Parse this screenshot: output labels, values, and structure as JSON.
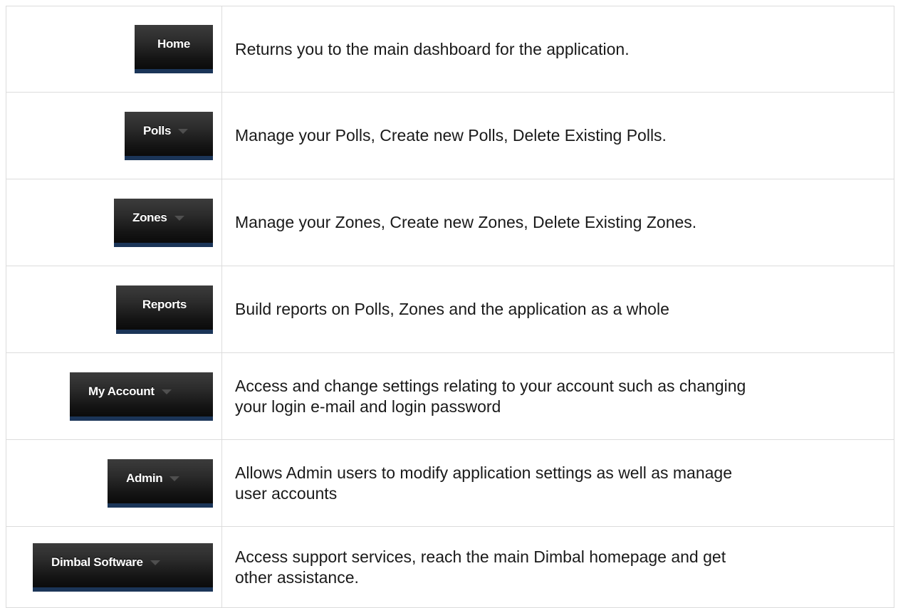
{
  "rows": [
    {
      "button_label": "Home",
      "has_caret": false,
      "description": "Returns you to the main dashboard for the application."
    },
    {
      "button_label": "Polls",
      "has_caret": true,
      "description": "Manage your Polls, Create new Polls, Delete Existing Polls."
    },
    {
      "button_label": "Zones",
      "has_caret": true,
      "description": "Manage your Zones, Create new Zones, Delete Existing Zones."
    },
    {
      "button_label": "Reports",
      "has_caret": false,
      "description": "Build reports on Polls, Zones and the application as a whole"
    },
    {
      "button_label": "My Account",
      "has_caret": true,
      "description_lines": [
        "Access and change settings relating to your account such as changing",
        "your login e-mail and login password"
      ]
    },
    {
      "button_label": "Admin",
      "has_caret": true,
      "description_lines": [
        "Allows Admin users to modify application settings as well as manage",
        "user accounts"
      ]
    },
    {
      "button_label": "Dimbal Software",
      "has_caret": true,
      "description_lines": [
        "Access support services, reach the main Dimbal homepage and get",
        "other assistance."
      ]
    }
  ],
  "icons": {
    "dropdown": "chevron-down-icon"
  },
  "colors": {
    "button_bg_top": "#3c3c3c",
    "button_bg_bottom": "#0b0b0b",
    "button_accent": "#1b3558",
    "button_text": "#ffffff",
    "caret": "#4f4f4f",
    "border": "#dcdcdc",
    "text": "#1a1a1a"
  }
}
